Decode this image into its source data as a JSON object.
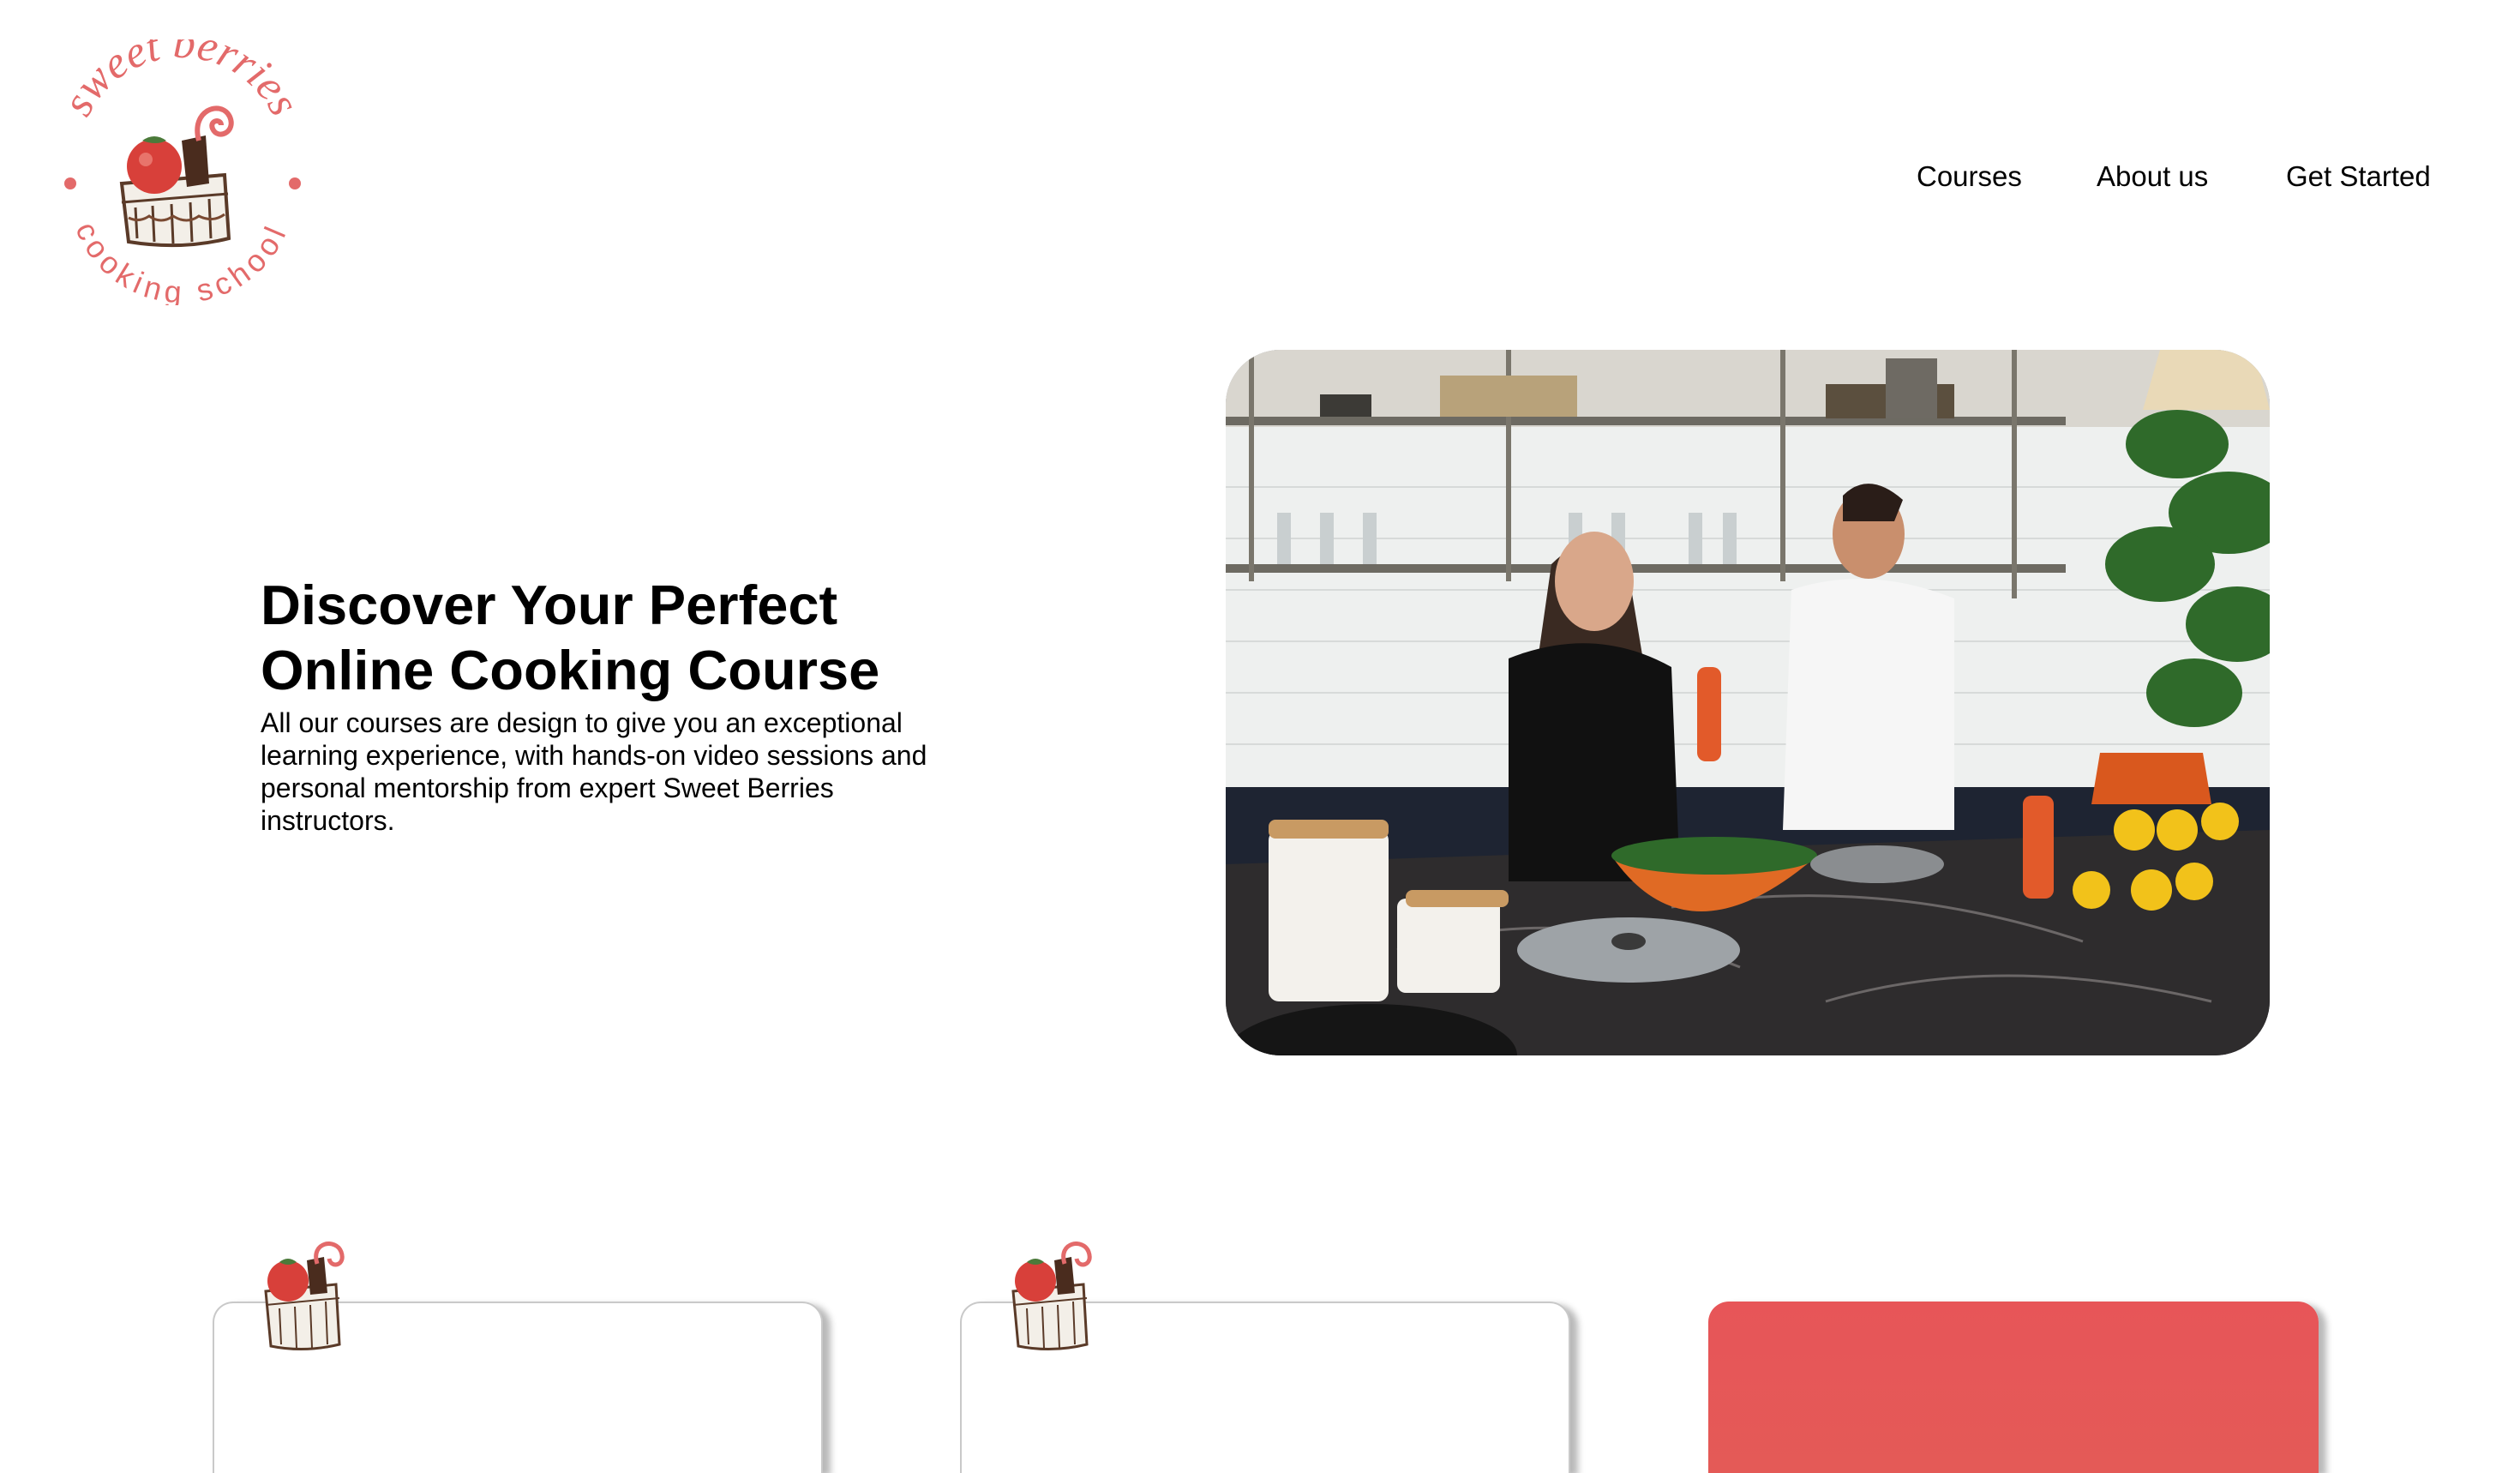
{
  "brand": {
    "name_top": "sweet berries",
    "name_bottom": "cooking school",
    "accent_color": "#e36a6a",
    "logo_icon": "cake-icon"
  },
  "nav": {
    "items": [
      {
        "label": "Courses"
      },
      {
        "label": "About us"
      },
      {
        "label": "Get Started"
      }
    ]
  },
  "hero": {
    "title_line1": "Discover Your Perfect",
    "title_line2": "Online Cooking Course",
    "body": "All our courses are design to give you an exceptional learning experience, with hands-on video sessions and personal mentorship from expert Sweet Berries instructors."
  },
  "cards": [
    {
      "icon": "cake-icon",
      "style": "outline"
    },
    {
      "icon": "cake-icon",
      "style": "outline"
    },
    {
      "style": "filled",
      "color": "#e75558"
    }
  ]
}
